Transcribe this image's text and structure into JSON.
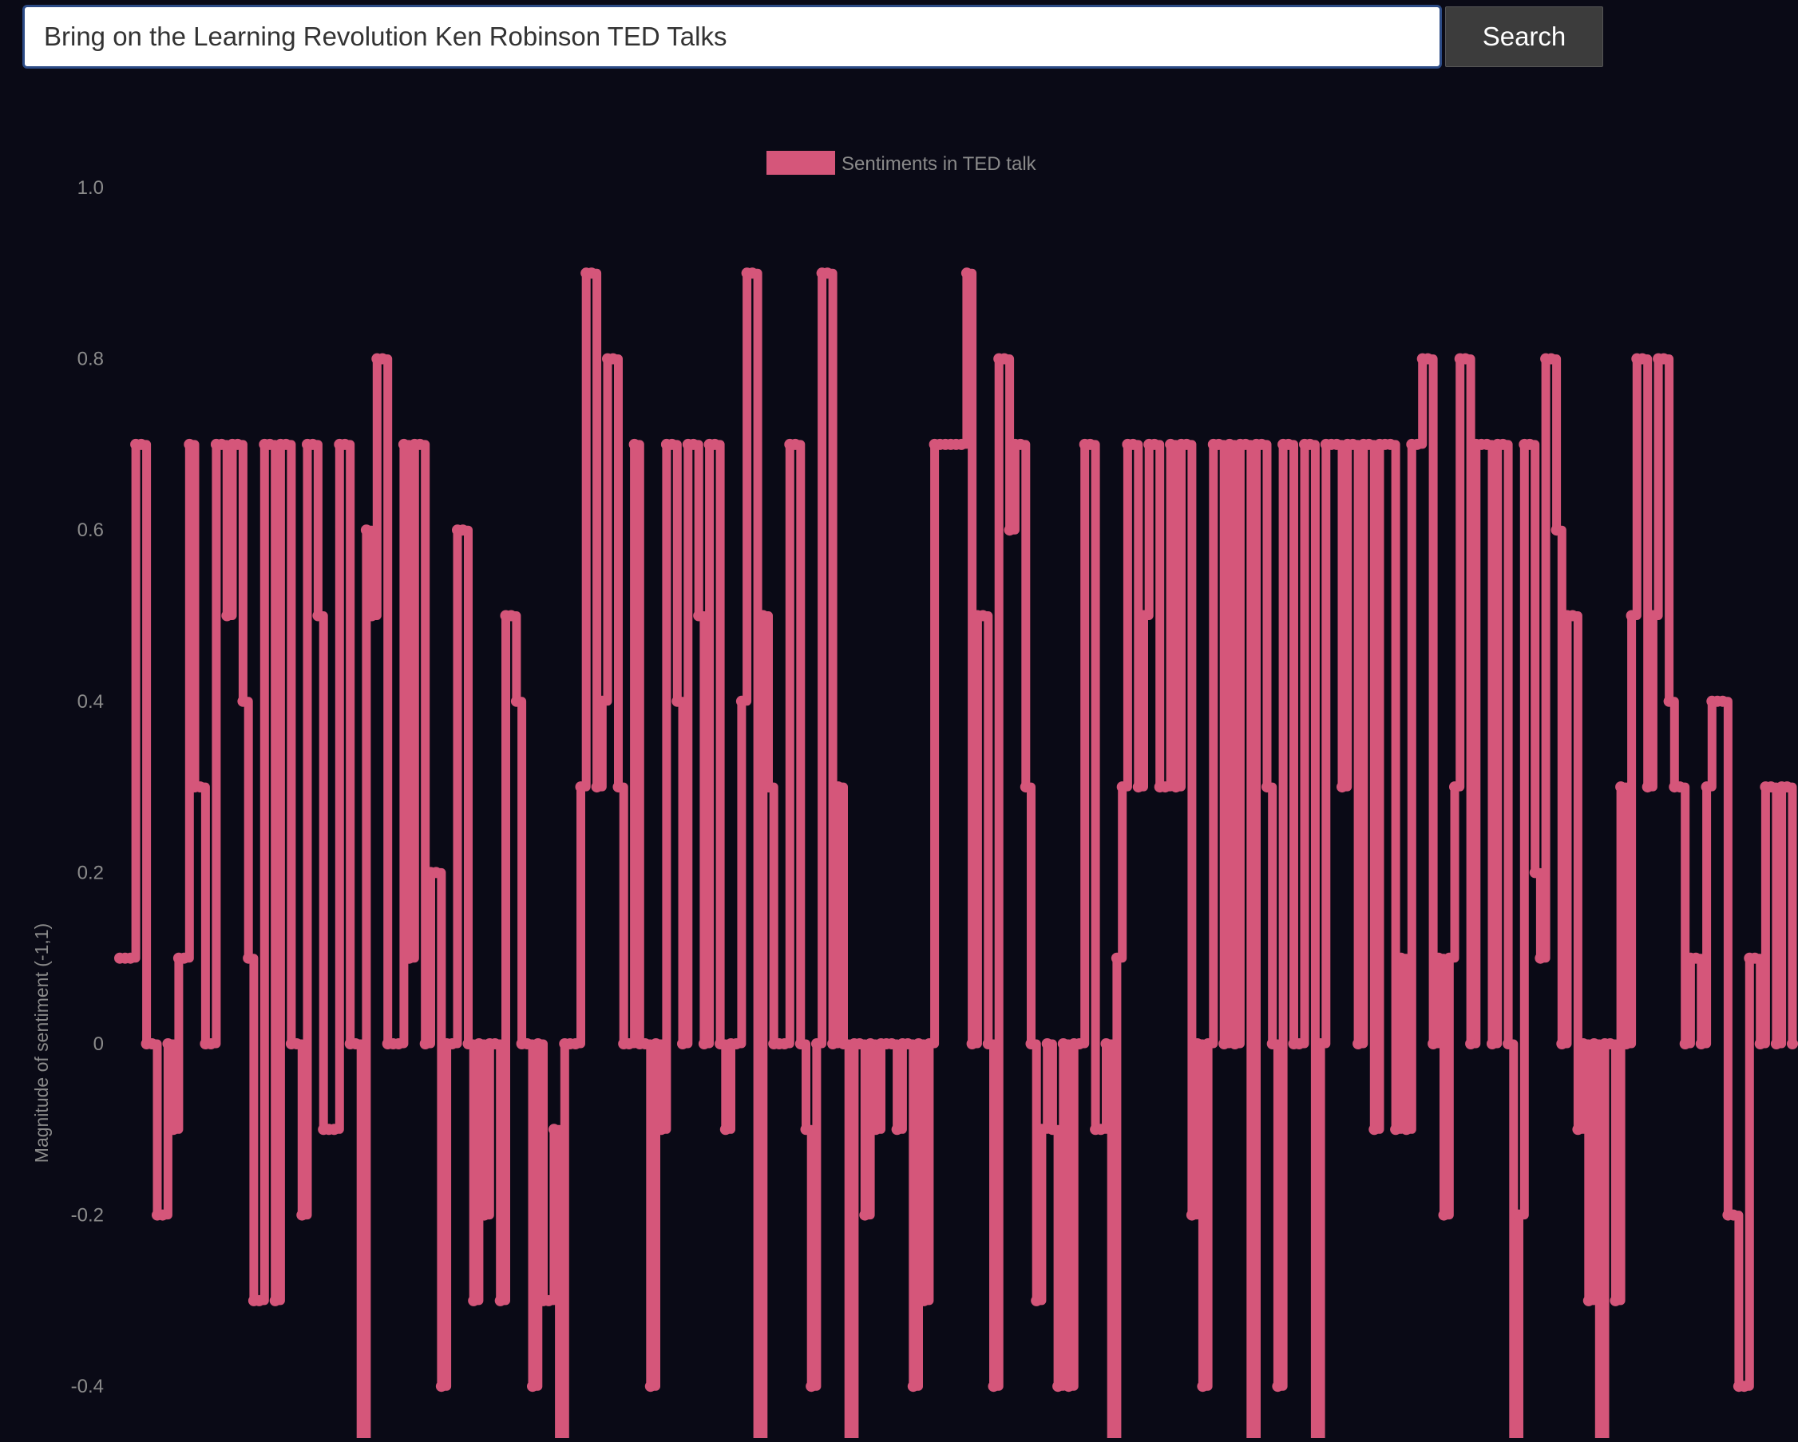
{
  "search": {
    "value": "Bring on the Learning Revolution Ken Robinson TED Talks",
    "button_label": "Search"
  },
  "colors": {
    "background": "#0a0a16",
    "series": "#d5567a",
    "tick_text": "#8a8a8a"
  },
  "chart_data": {
    "type": "line",
    "title": "",
    "legend": {
      "labels": [
        "Sentiments in TED talk"
      ],
      "position": "top"
    },
    "xlabel": "",
    "ylabel": "Magnitude of sentiment (-1,1)",
    "ylim": [
      -0.5,
      1.0
    ],
    "yticks": [
      1.0,
      0.8,
      0.6,
      0.4,
      0.2,
      0,
      -0.2,
      -0.4
    ],
    "ytick_labels": [
      "1.0",
      "0.8",
      "0.6",
      "0.4",
      "0.2",
      "0",
      "-0.2",
      "-0.4"
    ],
    "stepped": true,
    "grid": false,
    "series": [
      {
        "name": "Sentiments in TED talk",
        "values": [
          0.1,
          0.1,
          0.1,
          0.7,
          0.7,
          0,
          0,
          -0.2,
          -0.2,
          0,
          -0.1,
          0.1,
          0.1,
          0.7,
          0.3,
          0.3,
          0,
          0,
          0.7,
          0.7,
          0.5,
          0.7,
          0.7,
          0.4,
          0.1,
          -0.3,
          -0.3,
          0.7,
          0.7,
          -0.3,
          0.7,
          0.7,
          0,
          0,
          -0.2,
          0.7,
          0.7,
          0.5,
          -0.1,
          -0.1,
          -0.1,
          0.7,
          0.7,
          0,
          0,
          -0.5,
          0.6,
          0.5,
          0.8,
          0.8,
          0,
          0,
          0,
          0.7,
          0.1,
          0.7,
          0.7,
          0,
          0.2,
          0.2,
          -0.4,
          0,
          0,
          0.6,
          0.6,
          0,
          -0.3,
          0,
          -0.2,
          0,
          0,
          -0.3,
          0.5,
          0.5,
          0.4,
          0,
          0,
          -0.4,
          0,
          -0.3,
          -0.3,
          -0.1,
          -0.5,
          0,
          0,
          0,
          0.3,
          0.9,
          0.9,
          0.3,
          0.4,
          0.8,
          0.8,
          0.3,
          0,
          0,
          0.7,
          0,
          0,
          -0.4,
          0,
          -0.1,
          0.7,
          0.7,
          0.4,
          0,
          0.7,
          0.7,
          0.5,
          0,
          0.7,
          0.7,
          0,
          -0.1,
          0,
          0,
          0.4,
          0.9,
          0.9,
          -0.5,
          0.5,
          0.3,
          0,
          0,
          0,
          0.7,
          0.7,
          0,
          -0.1,
          -0.4,
          0,
          0.9,
          0.9,
          0,
          0.3,
          0,
          -0.5,
          0,
          0,
          -0.2,
          0,
          -0.1,
          0,
          0,
          0,
          -0.1,
          0,
          0,
          -0.4,
          0,
          -0.3,
          0,
          0.7,
          0.7,
          0.7,
          0.7,
          0.7,
          0.7,
          0.9,
          0,
          0.5,
          0.5,
          0,
          -0.4,
          0.8,
          0.8,
          0.6,
          0.7,
          0.7,
          0.3,
          0,
          -0.3,
          -0.1,
          0,
          -0.1,
          -0.4,
          0,
          -0.4,
          0,
          0,
          0.7,
          0.7,
          -0.1,
          -0.1,
          0,
          -0.5,
          0.1,
          0.3,
          0.7,
          0.7,
          0.3,
          0.5,
          0.7,
          0.7,
          0.3,
          0.3,
          0.7,
          0.3,
          0.7,
          0.7,
          -0.2,
          0,
          -0.4,
          0,
          0.7,
          0.7,
          0,
          0.7,
          0,
          0.7,
          0.7,
          -0.5,
          0.7,
          0.7,
          0.3,
          0,
          -0.4,
          0.7,
          0.7,
          0,
          0,
          0.7,
          0.7,
          -0.5,
          0,
          0.7,
          0.7,
          0.7,
          0.3,
          0.7,
          0.7,
          0,
          0.7,
          0.7,
          -0.1,
          0.7,
          0.7,
          0.7,
          -0.1,
          0.1,
          -0.1,
          0.7,
          0.7,
          0.8,
          0.8,
          0,
          0.1,
          -0.2,
          0.1,
          0.3,
          0.8,
          0.8,
          0,
          0.7,
          0.7,
          0.7,
          0,
          0.7,
          0.7,
          0,
          -0.5,
          -0.2,
          0.7,
          0.7,
          0.2,
          0.1,
          0.8,
          0.8,
          0.6,
          0,
          0.5,
          0.5,
          -0.1,
          0,
          -0.3,
          0,
          -0.5,
          0,
          0,
          -0.3,
          0.3,
          0,
          0.5,
          0.8,
          0.8,
          0.3,
          0.5,
          0.8,
          0.8,
          0.4,
          0.3,
          0.3,
          0,
          0.1,
          0.1,
          0,
          0.3,
          0.4,
          0.4,
          0.4,
          -0.2,
          -0.2,
          -0.4,
          -0.4,
          0.1,
          0.1,
          0,
          0.3,
          0.3,
          0,
          0.3,
          0.3,
          0
        ]
      }
    ]
  }
}
